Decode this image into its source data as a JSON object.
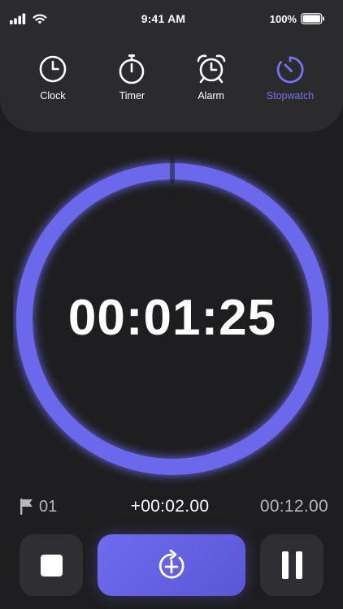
{
  "status_bar": {
    "time": "9:41 AM",
    "battery_percent": "100%",
    "icons": [
      "signal-icon",
      "wifi-icon",
      "battery-icon"
    ]
  },
  "tabs": [
    {
      "label": "Clock",
      "icon": "clock-icon",
      "active": false
    },
    {
      "label": "Timer",
      "icon": "timer-icon",
      "active": false
    },
    {
      "label": "Alarm",
      "icon": "alarm-icon",
      "active": false
    },
    {
      "label": "Stopwatch",
      "icon": "stopwatch-icon",
      "active": true
    }
  ],
  "stopwatch": {
    "elapsed": "00:01:25"
  },
  "lap": {
    "number": "01",
    "diff": "+00:02.00",
    "total": "00:12.00"
  },
  "controls": {
    "stop": "stop-icon",
    "lap": "lap-add-icon",
    "pause": "pause-icon"
  },
  "colors": {
    "accent": "#6c68ec",
    "background": "#1e1e20",
    "card": "#2b2b2e",
    "button": "#2f2f33"
  }
}
